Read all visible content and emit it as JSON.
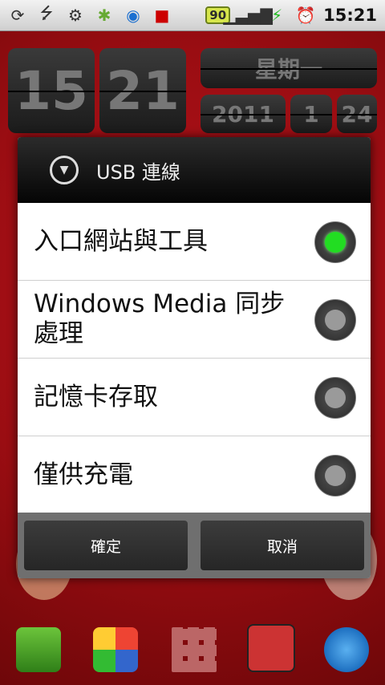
{
  "statusbar": {
    "battery_badge": "90",
    "time": "15:21"
  },
  "clock_widget": {
    "hour": "15",
    "minute": "21",
    "weekday": "星期一",
    "year": "2011",
    "month": "1",
    "day": "24"
  },
  "dialog": {
    "title": "USB 連線",
    "options": [
      {
        "label": "入口網站與工具",
        "selected": true
      },
      {
        "label": "Windows Media 同步處理",
        "selected": false
      },
      {
        "label": "記憶卡存取",
        "selected": false
      },
      {
        "label": "僅供充電",
        "selected": false
      }
    ],
    "ok_label": "確定",
    "cancel_label": "取消"
  },
  "colors": {
    "selected_radio": "#22dd22",
    "wallpaper": "#9a0d12"
  }
}
